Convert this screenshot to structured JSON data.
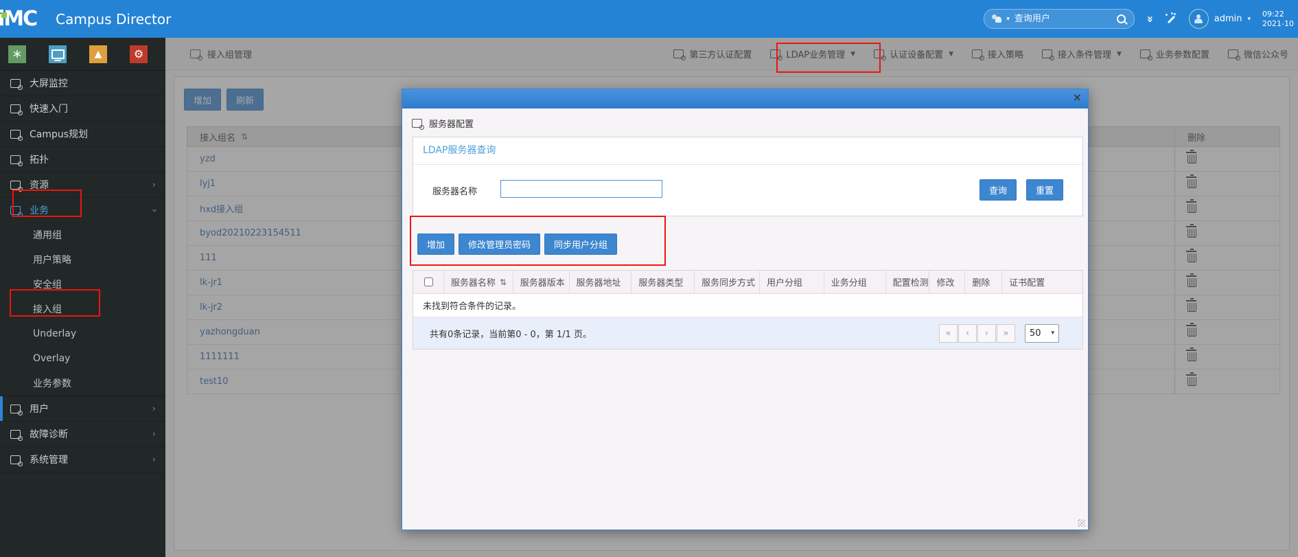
{
  "topbar": {
    "logo_text": "iMC",
    "product_title": "Campus Director",
    "search": {
      "placeholder": "查询用户"
    },
    "user": {
      "name": "admin"
    },
    "clock": {
      "time": "09:22",
      "date": "2021-10"
    }
  },
  "toolbar": {
    "breadcrumb": "接入组管理",
    "items": [
      {
        "label": "第三方认证配置",
        "icon": "third-party-auth-icon",
        "caret": false,
        "annotated": false
      },
      {
        "label": "LDAP业务管理",
        "icon": "ldap-service-icon",
        "caret": true,
        "annotated": true
      },
      {
        "label": "认证设备配置",
        "icon": "auth-device-icon",
        "caret": true,
        "annotated": false
      },
      {
        "label": "接入策略",
        "icon": "access-policy-icon",
        "caret": false,
        "annotated": false
      },
      {
        "label": "接入条件管理",
        "icon": "access-condition-icon",
        "caret": true,
        "annotated": false
      },
      {
        "label": "业务参数配置",
        "icon": "service-param-icon",
        "caret": false,
        "annotated": false
      },
      {
        "label": "微信公众号",
        "icon": "wechat-icon",
        "caret": false,
        "annotated": false
      }
    ]
  },
  "sidebar": {
    "tiles": [
      {
        "name": "favorites-tile",
        "color": "#649a63",
        "glyph": "asterisk"
      },
      {
        "name": "monitor-tile",
        "color": "#4e9ec4",
        "glyph": "monitor"
      },
      {
        "name": "alarm-tile",
        "color": "#df9f3f",
        "glyph": "triangle"
      },
      {
        "name": "settings-tile",
        "color": "#bf3a2b",
        "glyph": "gear"
      }
    ],
    "items": [
      {
        "id": "dashboard",
        "label": "大屏监控",
        "type": "top",
        "icon": "dashboard-icon"
      },
      {
        "id": "quickstart",
        "label": "快速入门",
        "type": "top",
        "icon": "home-icon"
      },
      {
        "id": "campus-plan",
        "label": "Campus规划",
        "type": "top",
        "icon": "clipboard-icon"
      },
      {
        "id": "topology",
        "label": "拓扑",
        "type": "top",
        "icon": "topology-icon"
      },
      {
        "id": "resource",
        "label": "资源",
        "type": "top",
        "icon": "resource-icon",
        "chevron": "right"
      },
      {
        "id": "service",
        "label": "业务",
        "type": "top",
        "icon": "service-icon",
        "chevron": "down",
        "active": true
      },
      {
        "id": "common-group",
        "label": "通用组",
        "type": "sub"
      },
      {
        "id": "user-policy",
        "label": "用户策略",
        "type": "sub"
      },
      {
        "id": "security-group",
        "label": "安全组",
        "type": "sub"
      },
      {
        "id": "access-group",
        "label": "接入组",
        "type": "sub"
      },
      {
        "id": "underlay",
        "label": "Underlay",
        "type": "sub"
      },
      {
        "id": "overlay",
        "label": "Overlay",
        "type": "sub"
      },
      {
        "id": "service-param",
        "label": "业务参数",
        "type": "sub"
      },
      {
        "id": "user",
        "label": "用户",
        "type": "top",
        "icon": "user-icon",
        "chevron": "right",
        "accent": true
      },
      {
        "id": "diagnosis",
        "label": "故障诊断",
        "type": "top",
        "icon": "diagnosis-icon",
        "chevron": "right"
      },
      {
        "id": "system",
        "label": "系统管理",
        "type": "top",
        "icon": "system-icon",
        "chevron": "right"
      }
    ]
  },
  "main": {
    "buttons": {
      "add": "增加",
      "refresh": "刷新"
    },
    "table": {
      "name_header": "接入组名",
      "sort_icon": "⇅",
      "delete_header": "删除",
      "rows": [
        "yzd",
        "lyj1",
        "hxd接入组",
        "byod20210223154511",
        "111",
        "lk-jr1",
        "lk-jr2",
        "yazhongduan",
        "1111111",
        "test10"
      ]
    }
  },
  "modal": {
    "title": "服务器配置",
    "close_label": "×",
    "query_panel": {
      "title": "LDAP服务器查询",
      "server_name_label": "服务器名称",
      "server_name_value": "",
      "query_button": "查询",
      "reset_button": "重置"
    },
    "actions": {
      "add": "增加",
      "change_admin_password": "修改管理员密码",
      "sync_user_groups": "同步用户分组"
    },
    "results": {
      "columns": [
        "服务器名称",
        "服务器版本",
        "服务器地址",
        "服务器类型",
        "服务同步方式",
        "用户分组",
        "业务分组",
        "配置检测",
        "修改",
        "删除",
        "证书配置"
      ],
      "sort_icon": "⇅",
      "empty_text": "未找到符合条件的记录。",
      "pagination": {
        "summary": "共有0条记录，当前第0 - 0，第 1/1 页。",
        "buttons": [
          "«",
          "‹",
          "›",
          "»"
        ],
        "page_size": "50"
      }
    }
  },
  "colors": {
    "topbar_blue": "#2583d5",
    "button_blue": "#3d86d0",
    "annotation_red": "#ec1414",
    "sidebar_bg": "#222827",
    "link_blue": "#2a67a5",
    "active_item_blue": "#4aa0e0"
  }
}
